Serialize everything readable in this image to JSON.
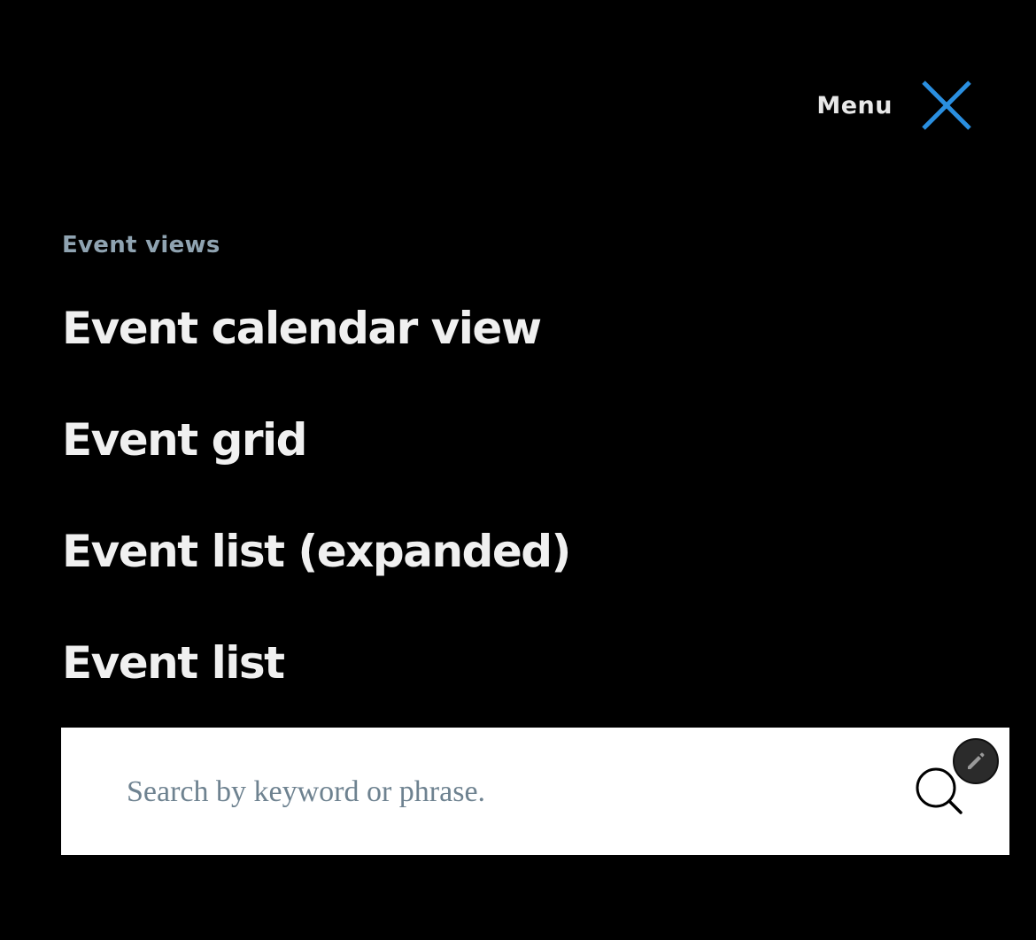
{
  "header": {
    "menu_label": "Menu",
    "close_icon": "close-icon",
    "accent_color": "#2a8fe0"
  },
  "event_views": {
    "heading": "Event views",
    "items": [
      {
        "label": "Event calendar view"
      },
      {
        "label": "Event grid"
      },
      {
        "label": "Event list (expanded)"
      },
      {
        "label": "Event list"
      }
    ]
  },
  "search": {
    "placeholder": "Search by keyword or phrase.",
    "value": "",
    "search_icon": "search-icon",
    "edit_icon": "pencil-icon"
  }
}
